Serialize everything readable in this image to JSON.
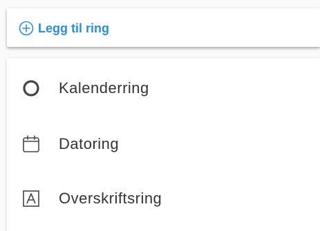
{
  "colors": {
    "accent": "#2a8fd6",
    "text": "#333333",
    "icon": "#444444"
  },
  "add_bar": {
    "button_label": "Legg til ring",
    "icon": "plus-circle-icon"
  },
  "menu": {
    "items": [
      {
        "label": "Kalenderring",
        "icon": "circle-ring-icon"
      },
      {
        "label": "Datoring",
        "icon": "calendar-icon"
      },
      {
        "label": "Overskriftsring",
        "icon": "letter-a-box-icon"
      }
    ]
  }
}
